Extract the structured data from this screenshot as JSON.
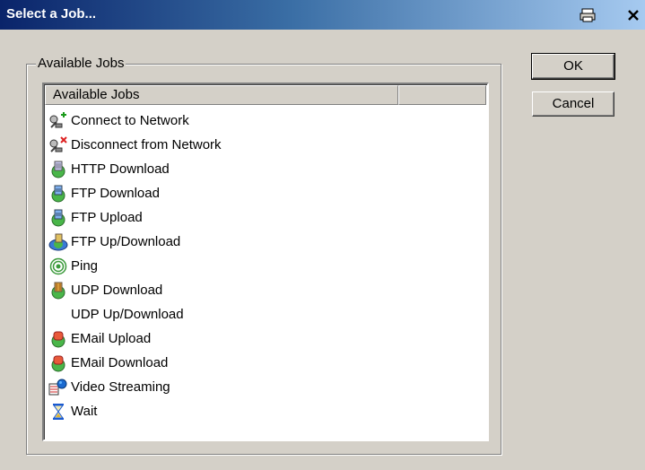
{
  "window": {
    "title": "Select a Job...",
    "buttons": [
      "printer-icon",
      "close-icon"
    ]
  },
  "group": {
    "label": "Available Jobs"
  },
  "list": {
    "columns": [
      "Available Jobs",
      ""
    ],
    "items": [
      {
        "label": "Connect to Network",
        "icon": "network-connect-icon"
      },
      {
        "label": "Disconnect from Network",
        "icon": "network-disconnect-icon"
      },
      {
        "label": "HTTP Download",
        "icon": "http-download-icon"
      },
      {
        "label": "FTP Download",
        "icon": "ftp-download-icon"
      },
      {
        "label": "FTP Upload",
        "icon": "ftp-upload-icon"
      },
      {
        "label": "FTP Up/Download",
        "icon": "ftp-updownload-icon"
      },
      {
        "label": "Ping",
        "icon": "ping-icon"
      },
      {
        "label": "UDP Download",
        "icon": "udp-download-icon"
      },
      {
        "label": "UDP Up/Download",
        "icon": ""
      },
      {
        "label": "EMail Upload",
        "icon": "email-upload-icon"
      },
      {
        "label": "EMail Download",
        "icon": "email-download-icon"
      },
      {
        "label": "Video Streaming",
        "icon": "video-streaming-icon"
      },
      {
        "label": "Wait",
        "icon": "hourglass-icon"
      }
    ]
  },
  "buttons": {
    "ok": "OK",
    "cancel": "Cancel"
  }
}
